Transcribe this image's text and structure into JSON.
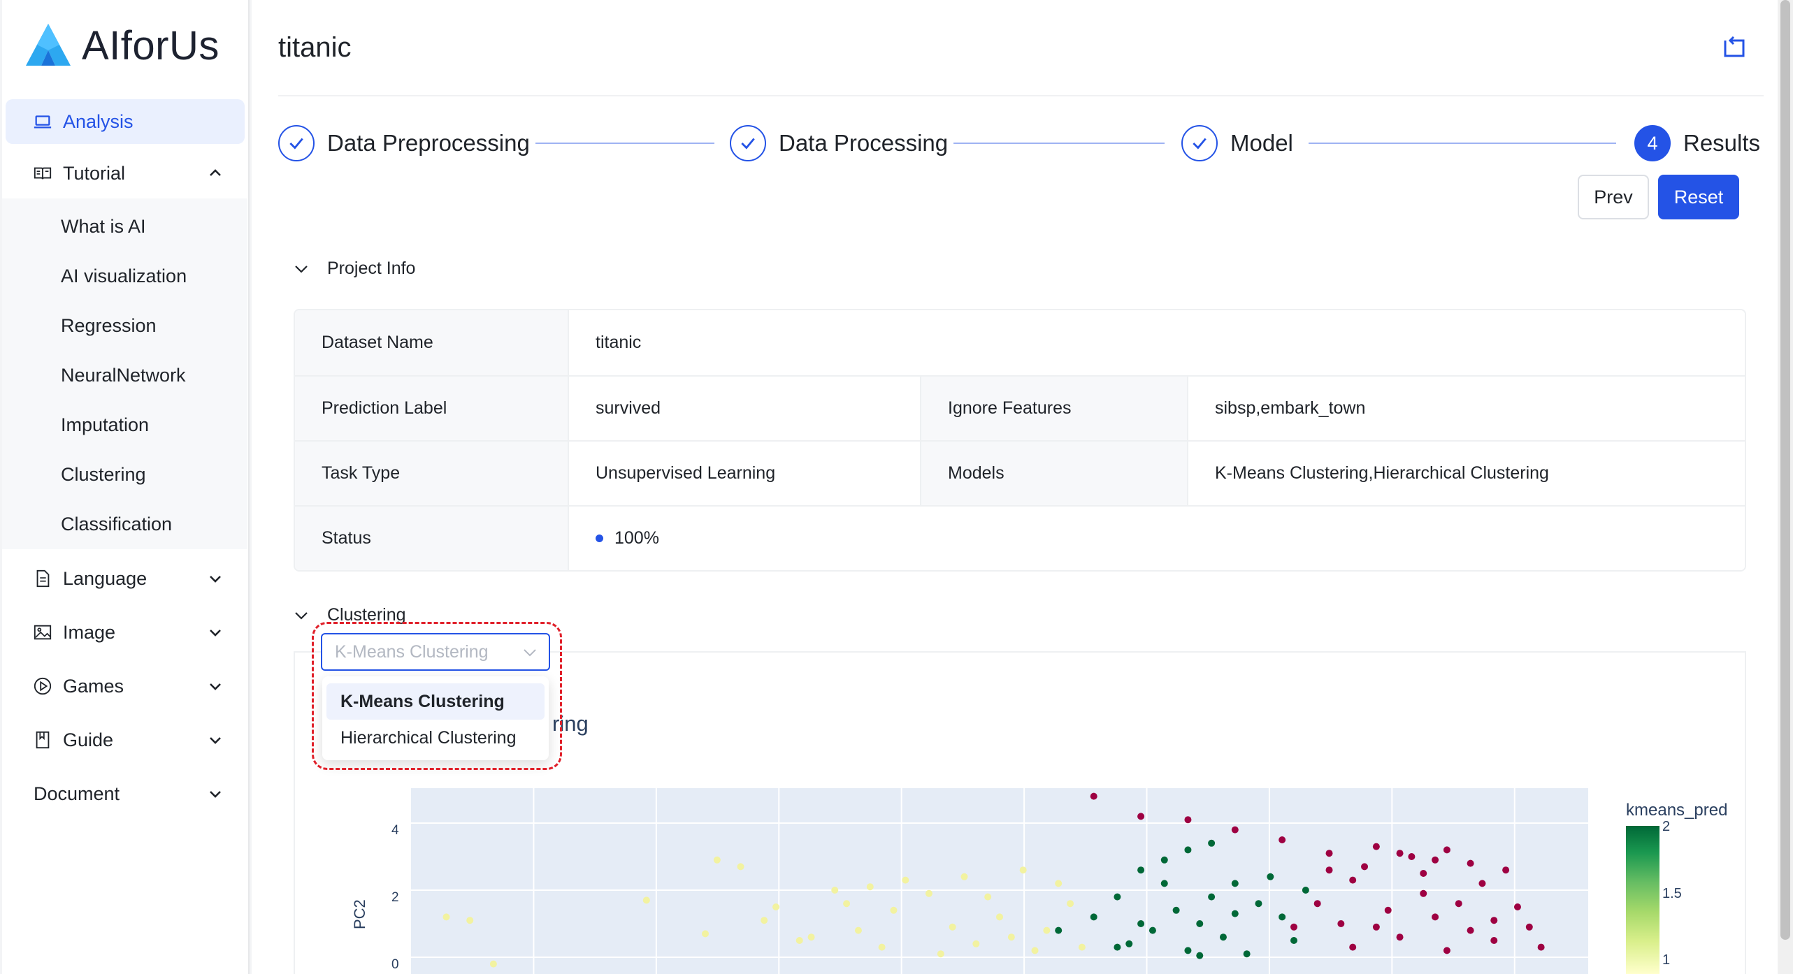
{
  "app": {
    "name": "AIforUs"
  },
  "sidebar": {
    "items": [
      {
        "label": "Analysis",
        "icon": "laptop-icon"
      },
      {
        "label": "Tutorial",
        "icon": "book-icon"
      },
      {
        "label": "Language",
        "icon": "file-icon"
      },
      {
        "label": "Image",
        "icon": "image-icon"
      },
      {
        "label": "Games",
        "icon": "play-icon"
      },
      {
        "label": "Guide",
        "icon": "bookmark-icon"
      },
      {
        "label": "Document"
      }
    ],
    "tutorial_sub": [
      "What is AI",
      "AI visualization",
      "Regression",
      "NeuralNetwork",
      "Imputation",
      "Clustering",
      "Classification"
    ]
  },
  "page": {
    "title": "titanic"
  },
  "steps": [
    {
      "label": "Data Preprocessing",
      "state": "done"
    },
    {
      "label": "Data Processing",
      "state": "done"
    },
    {
      "label": "Model",
      "state": "done"
    },
    {
      "label": "Results",
      "number": "4",
      "state": "current"
    }
  ],
  "buttons": {
    "prev": "Prev",
    "reset": "Reset"
  },
  "project_info": {
    "header": "Project Info",
    "dataset_name_label": "Dataset Name",
    "dataset_name": "titanic",
    "prediction_label_label": "Prediction Label",
    "prediction_label": "survived",
    "ignore_features_label": "Ignore Features",
    "ignore_features": "sibsp,embark_town",
    "task_type_label": "Task Type",
    "task_type": "Unsupervised Learning",
    "models_label": "Models",
    "models": "K-Means Clustering,Hierarchical Clustering",
    "status_label": "Status",
    "status": "100%"
  },
  "clustering": {
    "header": "Clustering",
    "select_placeholder": "K-Means Clustering",
    "options": [
      "K-Means Clustering",
      "Hierarchical Clustering"
    ],
    "chart_title_fragment": "ring"
  },
  "colors": {
    "accent": "#2453e6",
    "highlight": "#e0202a"
  },
  "chart_data": {
    "type": "scatter",
    "ylabel": "PC2",
    "y_ticks": [
      "4",
      "2",
      "0"
    ],
    "legend_title": "kmeans_pred",
    "colorbar_ticks": [
      "2",
      "1.5",
      "1"
    ],
    "series": [
      {
        "name": "2",
        "color": "#006837",
        "points": [
          [
            0.62,
            2.6
          ],
          [
            0.64,
            2.9
          ],
          [
            0.66,
            3.2
          ],
          [
            0.68,
            3.4
          ],
          [
            0.7,
            2.2
          ],
          [
            0.6,
            1.8
          ],
          [
            0.65,
            1.4
          ],
          [
            0.72,
            1.6
          ],
          [
            0.67,
            1.0
          ],
          [
            0.63,
            0.8
          ],
          [
            0.69,
            0.6
          ],
          [
            0.74,
            1.2
          ],
          [
            0.61,
            0.4
          ],
          [
            0.66,
            0.2
          ],
          [
            0.71,
            0.1
          ],
          [
            0.58,
            1.2
          ],
          [
            0.55,
            0.8
          ],
          [
            0.73,
            2.4
          ],
          [
            0.76,
            2.0
          ],
          [
            0.64,
            2.2
          ],
          [
            0.68,
            1.8
          ],
          [
            0.7,
            1.3
          ],
          [
            0.62,
            1.0
          ],
          [
            0.6,
            0.3
          ],
          [
            0.75,
            0.5
          ],
          [
            0.67,
            0.05
          ]
        ]
      },
      {
        "name": "1",
        "color": "#9e0142",
        "points": [
          [
            0.58,
            4.8
          ],
          [
            0.62,
            4.2
          ],
          [
            0.66,
            4.1
          ],
          [
            0.7,
            3.8
          ],
          [
            0.74,
            3.5
          ],
          [
            0.78,
            3.1
          ],
          [
            0.82,
            3.3
          ],
          [
            0.85,
            3.0
          ],
          [
            0.88,
            3.2
          ],
          [
            0.9,
            2.8
          ],
          [
            0.86,
            2.5
          ],
          [
            0.8,
            2.3
          ],
          [
            0.77,
            1.6
          ],
          [
            0.83,
            1.4
          ],
          [
            0.87,
            1.2
          ],
          [
            0.9,
            0.8
          ],
          [
            0.92,
            0.5
          ],
          [
            0.94,
            1.5
          ],
          [
            0.95,
            0.9
          ],
          [
            0.84,
            0.6
          ],
          [
            0.8,
            0.3
          ],
          [
            0.88,
            0.2
          ],
          [
            0.91,
            2.2
          ],
          [
            0.93,
            2.6
          ],
          [
            0.79,
            1.0
          ],
          [
            0.86,
            1.9
          ],
          [
            0.82,
            0.9
          ],
          [
            0.89,
            1.6
          ],
          [
            0.96,
            0.3
          ],
          [
            0.75,
            0.9
          ],
          [
            0.81,
            2.7
          ],
          [
            0.84,
            3.1
          ],
          [
            0.87,
            2.9
          ],
          [
            0.92,
            1.1
          ],
          [
            0.78,
            2.6
          ]
        ]
      },
      {
        "name": "0",
        "color": "#f2f2a0",
        "points": [
          [
            0.03,
            1.2
          ],
          [
            0.05,
            1.1
          ],
          [
            0.07,
            -0.2
          ],
          [
            0.2,
            1.7
          ],
          [
            0.25,
            0.7
          ],
          [
            0.28,
            2.7
          ],
          [
            0.26,
            2.9
          ],
          [
            0.3,
            1.1
          ],
          [
            0.36,
            2.0
          ],
          [
            0.38,
            0.8
          ],
          [
            0.41,
            1.4
          ],
          [
            0.44,
            1.9
          ],
          [
            0.47,
            2.4
          ],
          [
            0.48,
            0.4
          ],
          [
            0.5,
            1.2
          ],
          [
            0.52,
            2.6
          ],
          [
            0.54,
            0.8
          ],
          [
            0.56,
            1.6
          ],
          [
            0.53,
            0.2
          ],
          [
            0.46,
            0.9
          ],
          [
            0.42,
            2.3
          ],
          [
            0.39,
            2.1
          ],
          [
            0.34,
            0.6
          ],
          [
            0.31,
            1.5
          ],
          [
            0.33,
            0.5
          ],
          [
            0.49,
            1.8
          ],
          [
            0.51,
            0.6
          ],
          [
            0.57,
            0.3
          ],
          [
            0.55,
            2.2
          ],
          [
            0.45,
            0.1
          ],
          [
            0.4,
            0.3
          ],
          [
            0.37,
            1.6
          ]
        ]
      }
    ]
  }
}
